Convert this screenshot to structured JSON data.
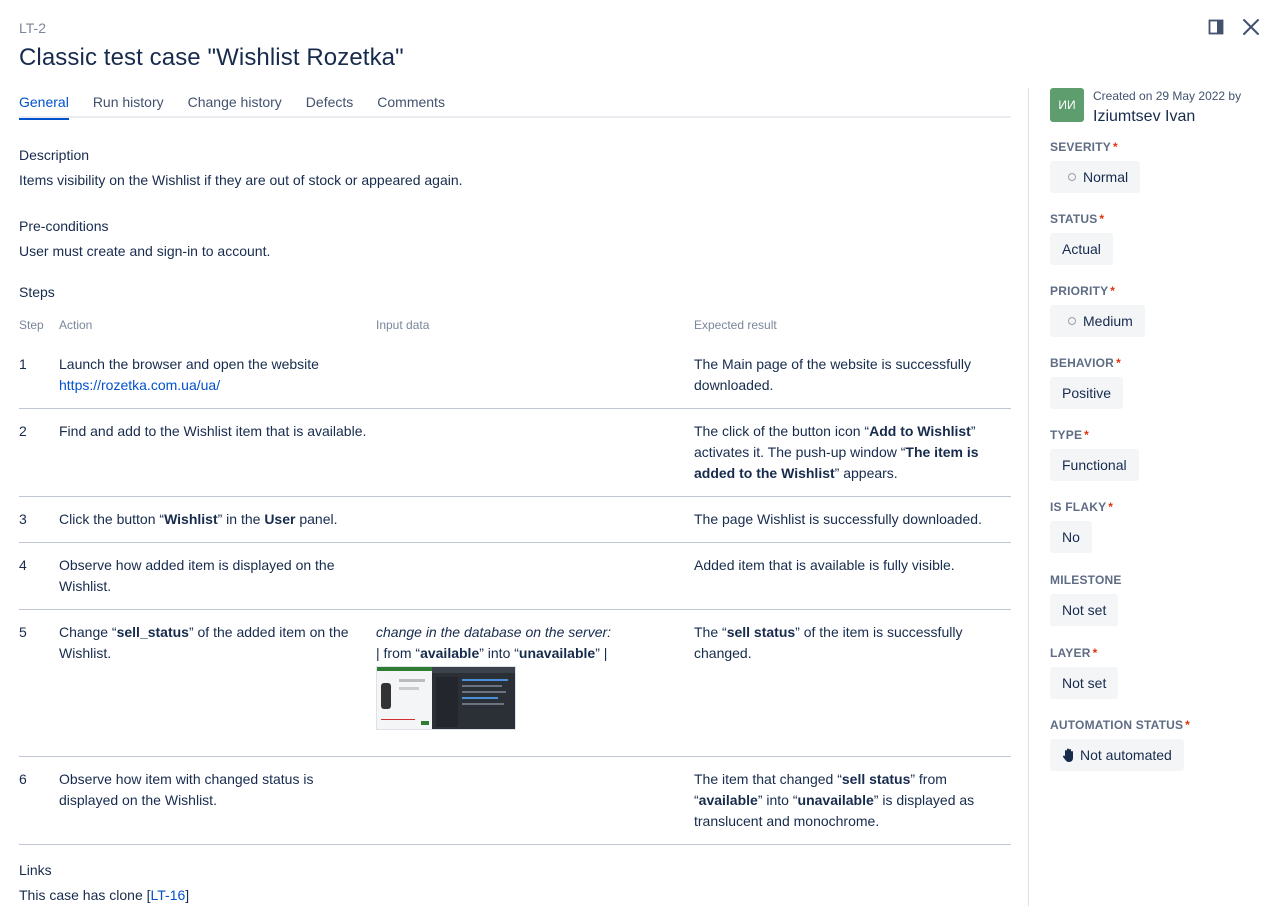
{
  "header": {
    "key": "LT-2",
    "title": "Classic test case \"Wishlist Rozetka\""
  },
  "tabs": [
    {
      "label": "General"
    },
    {
      "label": "Run history"
    },
    {
      "label": "Change history"
    },
    {
      "label": "Defects"
    },
    {
      "label": "Comments"
    }
  ],
  "description": {
    "label": "Description",
    "text": "Items visibility on the Wishlist if they are out of stock or appeared again."
  },
  "preconditions": {
    "label": "Pre-conditions",
    "text": "User must create and sign-in to account."
  },
  "steps": {
    "label": "Steps",
    "headers": {
      "step": "Step",
      "action": "Action",
      "input": "Input data",
      "expected": "Expected result"
    },
    "rows": [
      {
        "num": "1",
        "action_text": "Launch the browser and open the website",
        "action_link": "https://rozetka.com.ua/ua/",
        "expected": "The Main page of the website is successfully downloaded."
      },
      {
        "num": "2",
        "action": "Find and add to the Wishlist item that is available.",
        "expected_1": "The click of the button icon “",
        "expected_b1": "Add to Wishlist",
        "expected_2": "” activates it. The push-up window “",
        "expected_b2": "The item is added to the Wishlist",
        "expected_3": "” appears."
      },
      {
        "num": "3",
        "action_1": "Click the button “",
        "action_b1": "Wishlist",
        "action_2": "” in the ",
        "action_b2": "User",
        "action_3": " panel.",
        "expected": "The page Wishlist is successfully downloaded."
      },
      {
        "num": "4",
        "action": "Observe how added item is displayed on the Wishlist.",
        "expected": "Added item that is available is fully visible."
      },
      {
        "num": "5",
        "action_1": "Change “",
        "action_b1": "sell_status",
        "action_2": "” of the added item on the Wishlist.",
        "input_italic": "change in the database on the server:",
        "input_1": "| from “",
        "input_b1": "available",
        "input_2": "” into “",
        "input_b2": "unavailable",
        "input_3": "” |",
        "expected_1": "The “",
        "expected_b1": "sell status",
        "expected_2": "” of the item is successfully changed."
      },
      {
        "num": "6",
        "action": "Observe how item with changed status is displayed on the Wishlist.",
        "expected_1": "The item that changed “",
        "expected_b1": "sell status",
        "expected_2": "” from “",
        "expected_b2": "available",
        "expected_3": "” into “",
        "expected_b3": "unavailable",
        "expected_4": "” is displayed as translucent and monochrome."
      }
    ]
  },
  "links": {
    "label": "Links",
    "text": "This case has clone ",
    "bracket_open": "[",
    "link": "LT-16",
    "bracket_close": "]"
  },
  "sidebar": {
    "avatar_initials": "ИИ",
    "created_on": "Created on 29 May 2022 by",
    "created_by": "Iziumtsev Ivan",
    "fields": [
      {
        "label": "SEVERITY",
        "value": "Normal",
        "required": true,
        "icon": "circle-dot-icon"
      },
      {
        "label": "STATUS",
        "value": "Actual",
        "required": true
      },
      {
        "label": "PRIORITY",
        "value": "Medium",
        "required": true,
        "icon": "circle-dot-icon"
      },
      {
        "label": "BEHAVIOR",
        "value": "Positive",
        "required": true
      },
      {
        "label": "TYPE",
        "value": "Functional",
        "required": true
      },
      {
        "label": "IS FLAKY",
        "value": "No",
        "required": true
      },
      {
        "label": "MILESTONE",
        "value": "Not set",
        "required": false
      },
      {
        "label": "LAYER",
        "value": "Not set",
        "required": true
      },
      {
        "label": "AUTOMATION STATUS",
        "value": "Not automated",
        "required": true,
        "icon": "hand-icon"
      }
    ],
    "required_mark": "*"
  },
  "colors": {
    "accent": "#0052cc",
    "text": "#172b4d",
    "muted": "#7a869a",
    "required": "#de350b",
    "avatar": "#5e9e6e"
  }
}
